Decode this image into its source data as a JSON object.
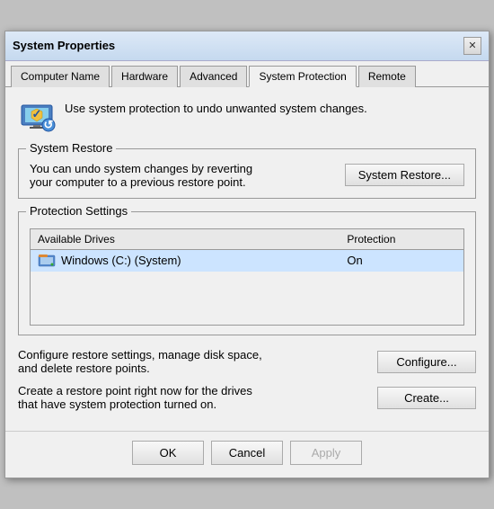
{
  "window": {
    "title": "System Properties",
    "close_icon": "✕"
  },
  "tabs": [
    {
      "id": "computer-name",
      "label": "Computer Name",
      "active": false
    },
    {
      "id": "hardware",
      "label": "Hardware",
      "active": false
    },
    {
      "id": "advanced",
      "label": "Advanced",
      "active": false
    },
    {
      "id": "system-protection",
      "label": "System Protection",
      "active": true
    },
    {
      "id": "remote",
      "label": "Remote",
      "active": false
    }
  ],
  "info": {
    "text": "Use system protection to undo unwanted system changes."
  },
  "system_restore": {
    "group_label": "System Restore",
    "description": "You can undo system changes by reverting your computer to a previous restore point.",
    "button_label": "System Restore..."
  },
  "protection_settings": {
    "group_label": "Protection Settings",
    "columns": [
      "Available Drives",
      "Protection"
    ],
    "rows": [
      {
        "drive": "Windows (C:) (System)",
        "protection": "On",
        "selected": true
      }
    ]
  },
  "configure": {
    "description": "Configure restore settings, manage disk space, and delete restore points.",
    "button_label": "Configure..."
  },
  "create": {
    "description": "Create a restore point right now for the drives that have system protection turned on.",
    "button_label": "Create..."
  },
  "footer": {
    "ok_label": "OK",
    "cancel_label": "Cancel",
    "apply_label": "Apply"
  }
}
